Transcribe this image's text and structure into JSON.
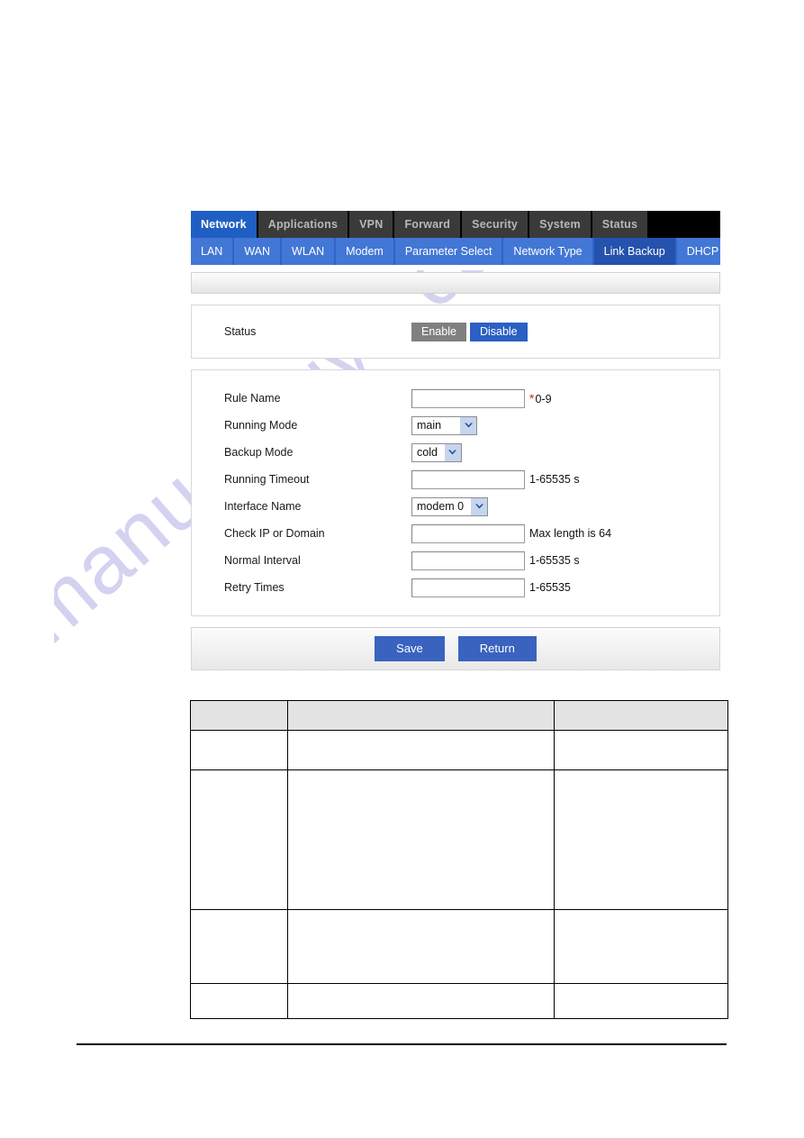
{
  "nav": {
    "main_tabs": [
      {
        "label": "Network",
        "active": true
      },
      {
        "label": "Applications",
        "active": false
      },
      {
        "label": "VPN",
        "active": false
      },
      {
        "label": "Forward",
        "active": false
      },
      {
        "label": "Security",
        "active": false
      },
      {
        "label": "System",
        "active": false
      },
      {
        "label": "Status",
        "active": false
      }
    ],
    "sub_tabs": [
      {
        "label": "LAN",
        "active": false
      },
      {
        "label": "WAN",
        "active": false
      },
      {
        "label": "WLAN",
        "active": false
      },
      {
        "label": "Modem",
        "active": false
      },
      {
        "label": "Parameter Select",
        "active": false
      },
      {
        "label": "Network Type",
        "active": false
      },
      {
        "label": "Link Backup",
        "active": true
      },
      {
        "label": "DHCP Server",
        "active": false
      }
    ]
  },
  "status_panel": {
    "label": "Status",
    "enable_label": "Enable",
    "disable_label": "Disable",
    "selected": "Disable"
  },
  "form": {
    "rule_name": {
      "label": "Rule Name",
      "value": "",
      "hint_star": "*",
      "hint": "0-9"
    },
    "running_mode": {
      "label": "Running Mode",
      "value": "main"
    },
    "backup_mode": {
      "label": "Backup Mode",
      "value": "cold"
    },
    "running_timeout": {
      "label": "Running Timeout",
      "value": "",
      "hint": "1-65535 s"
    },
    "interface_name": {
      "label": "Interface Name",
      "value": "modem 0"
    },
    "check_ip_or_domain": {
      "label": "Check IP or Domain",
      "value": "",
      "hint": "Max length is 64"
    },
    "normal_interval": {
      "label": "Normal Interval",
      "value": "",
      "hint": "1-65535 s"
    },
    "retry_times": {
      "label": "Retry Times",
      "value": "",
      "hint": "1-65535"
    }
  },
  "actions": {
    "save_label": "Save",
    "return_label": "Return"
  },
  "doc_table": {
    "headers": [
      "",
      "",
      ""
    ],
    "rows": [
      [
        "",
        "",
        ""
      ],
      [
        "",
        "",
        ""
      ],
      [
        "",
        "",
        ""
      ],
      [
        "",
        "",
        ""
      ]
    ]
  },
  "watermark": {
    "text": "manualshive.com"
  },
  "colors": {
    "active_tab_blue": "#1f5fc4",
    "subtab_blue": "#4277d6",
    "subtab_active_blue": "#2552ad",
    "button_blue": "#3963bf",
    "disabled_gray": "#808080",
    "required_red": "#d21f1f"
  }
}
